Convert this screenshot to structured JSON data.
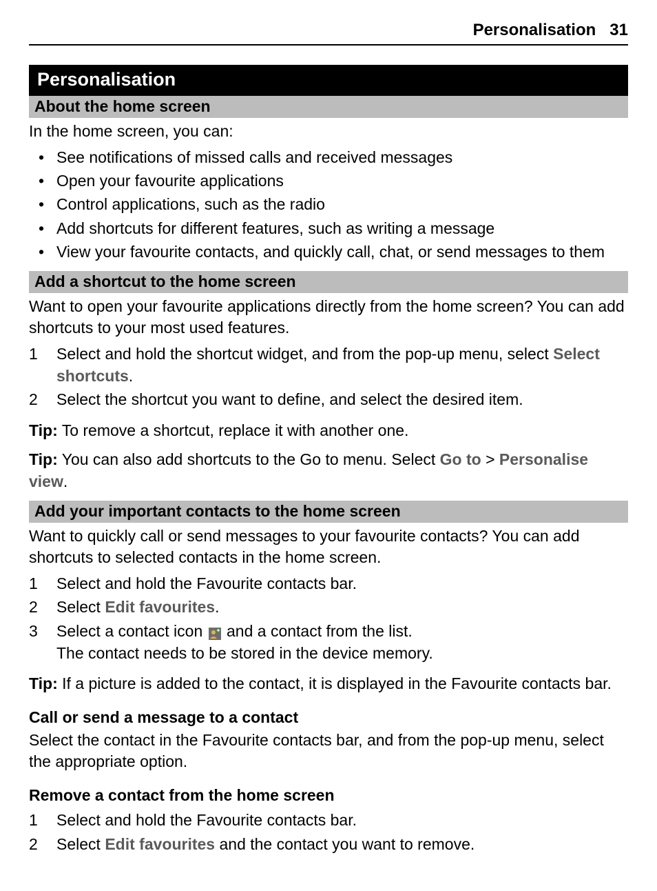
{
  "header": {
    "title": "Personalisation",
    "page_number": "31"
  },
  "section_title": "Personalisation",
  "about": {
    "heading": "About the home screen",
    "intro": "In the home screen, you can:",
    "bullets": [
      "See notifications of missed calls and received messages",
      "Open your favourite applications",
      "Control applications, such as the radio",
      "Add shortcuts for different features, such as writing a message",
      "View your favourite contacts, and quickly call, chat, or send messages to them"
    ]
  },
  "add_shortcut": {
    "heading": "Add a shortcut to the home screen",
    "intro": "Want to open your favourite applications directly from the home screen? You can add shortcuts to your most used features.",
    "steps": {
      "s1_pre": "Select and hold the shortcut widget, and from the pop-up menu, select ",
      "s1_action": "Select shortcuts",
      "s1_post": ".",
      "s2": "Select the shortcut you want to define, and select the desired item."
    },
    "tip1": {
      "label": "Tip:",
      "text": " To remove a shortcut, replace it with another one."
    },
    "tip2": {
      "label": "Tip:",
      "pre": " You can also add shortcuts to the Go to menu. Select ",
      "goto": "Go to",
      "gt": " > ",
      "personalise": "Personalise view",
      "post": "."
    }
  },
  "add_contacts": {
    "heading": "Add your important contacts to the home screen",
    "intro": "Want to quickly call or send messages to your favourite contacts? You can add shortcuts to selected contacts in the home screen.",
    "steps": {
      "s1": "Select and hold the Favourite contacts bar.",
      "s2_pre": "Select ",
      "s2_action": "Edit favourites",
      "s2_post": ".",
      "s3_pre": "Select a contact icon ",
      "s3_post": " and a contact from the list.",
      "s3_note": "The contact needs to be stored in the device memory."
    },
    "tip": {
      "label": "Tip:",
      "text": " If a picture is added to the contact, it is displayed in the Favourite contacts bar."
    }
  },
  "call_send": {
    "heading": "Call or send a message to a contact",
    "text": "Select the contact in the Favourite contacts bar, and from the pop-up menu, select the appropriate option."
  },
  "remove_contact": {
    "heading": "Remove a contact from the home screen",
    "steps": {
      "s1": "Select and hold the Favourite contacts bar.",
      "s2_pre": "Select ",
      "s2_action": "Edit favourites",
      "s2_post": " and the contact you want to remove."
    }
  },
  "numerals": {
    "n1": "1",
    "n2": "2",
    "n3": "3"
  },
  "bullet_char": "•"
}
